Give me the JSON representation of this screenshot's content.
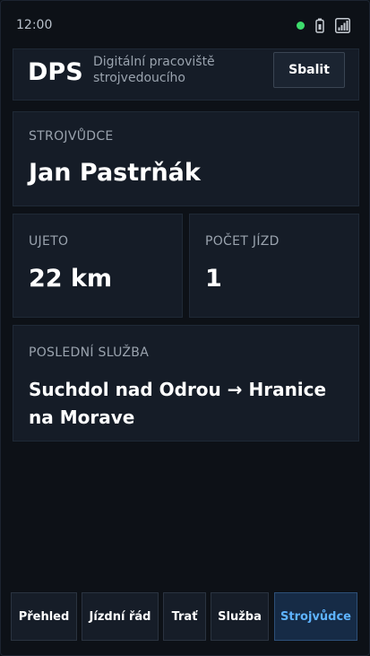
{
  "status_bar": {
    "time": "12:00"
  },
  "header": {
    "brand": "DPS",
    "subtitle": "Digitální pracoviště strojvedoucího",
    "collapse_label": "Sbalit"
  },
  "driver": {
    "label": "STROJVŮDCE",
    "name": "Jan Pastrňák"
  },
  "stats": {
    "distance_label": "UJETO",
    "distance_value": "22 km",
    "rides_label": "POČET JÍZD",
    "rides_value": "1"
  },
  "last_service": {
    "label": "POSLEDNÍ SLUŽBA",
    "route": "Suchdol nad Odrou → Hranice na Morave"
  },
  "tabs": [
    {
      "label": "Přehled"
    },
    {
      "label": "Jízdní řád"
    },
    {
      "label": "Trať"
    },
    {
      "label": "Služba"
    },
    {
      "label": "Strojvůdce"
    }
  ],
  "active_tab": "Strojvůdce",
  "colors": {
    "accent": "#5eb3ff",
    "online": "#3ddc6c",
    "background": "#0d1117"
  }
}
